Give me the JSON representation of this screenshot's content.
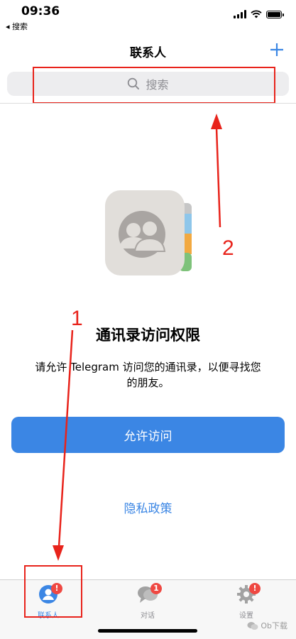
{
  "status_bar": {
    "time": "09:36",
    "back_label": "◂ 搜索"
  },
  "nav": {
    "title": "联系人",
    "add_symbol": "+"
  },
  "search": {
    "placeholder": "搜索"
  },
  "main": {
    "title": "通讯录访问权限",
    "description_line1": "请允许 Telegram 访问您的通讯录，以便寻找您",
    "description_line2": "的朋友。",
    "allow_button": "允许访问",
    "privacy_link": "隐私政策"
  },
  "annotations": {
    "label_1": "1",
    "label_2": "2"
  },
  "tabbar": {
    "tabs": [
      {
        "label": "联系人",
        "icon": "person-icon",
        "badge": "!",
        "selected": true
      },
      {
        "label": "对话",
        "icon": "chat-bubbles-icon",
        "badge": "1",
        "selected": false
      },
      {
        "label": "设置",
        "icon": "gear-icon",
        "badge": "!",
        "selected": false
      }
    ]
  },
  "watermark": {
    "text": "Ob下载"
  },
  "colors": {
    "accent": "#3b86e4",
    "annotation": "#e8231b",
    "badge": "#ef4842"
  }
}
